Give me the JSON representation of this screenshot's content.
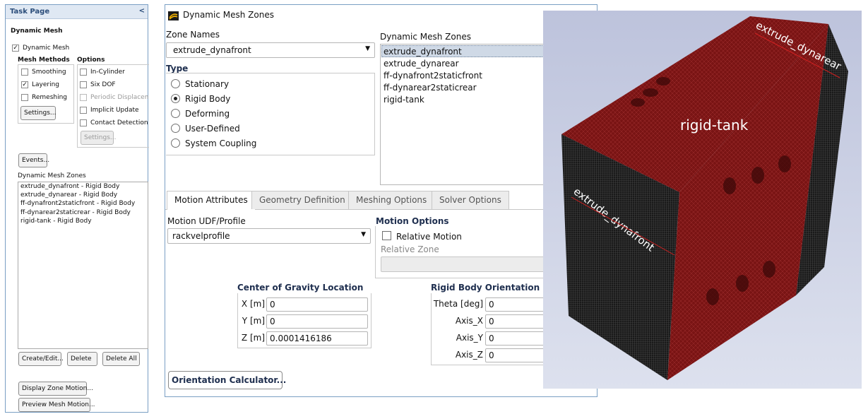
{
  "task_page": {
    "header": "Task Page",
    "collapse": "<",
    "title": "Dynamic Mesh",
    "dynamic_mesh_checkbox": "Dynamic Mesh",
    "mesh_methods_label": "Mesh Methods",
    "options_label": "Options",
    "mesh_methods": [
      {
        "label": "Smoothing",
        "checked": false
      },
      {
        "label": "Layering",
        "checked": true
      },
      {
        "label": "Remeshing",
        "checked": false
      }
    ],
    "mesh_settings_button": "Settings...",
    "options": [
      {
        "label": "In-Cylinder",
        "checked": false,
        "enabled": true
      },
      {
        "label": "Six DOF",
        "checked": false,
        "enabled": true
      },
      {
        "label": "Periodic Displaceme",
        "checked": false,
        "enabled": false
      },
      {
        "label": "Implicit Update",
        "checked": false,
        "enabled": true
      },
      {
        "label": "Contact Detection",
        "checked": false,
        "enabled": true
      }
    ],
    "options_settings_button": "Settings...",
    "events_button": "Events...",
    "zones_label": "Dynamic Mesh Zones",
    "zones": [
      "extrude_dynafront - Rigid Body",
      "extrude_dynarear - Rigid Body",
      "ff-dynafront2staticfront - Rigid Body",
      "ff-dynarear2staticrear - Rigid Body",
      "rigid-tank - Rigid Body"
    ],
    "create_edit_button": "Create/Edit...",
    "delete_button": "Delete",
    "delete_all_button": "Delete All",
    "display_zone_motion_button": "Display Zone Motion...",
    "preview_mesh_motion_button": "Preview Mesh Motion..."
  },
  "dialog": {
    "title": "Dynamic Mesh Zones",
    "zone_names_label": "Zone Names",
    "zone_name_value": "extrude_dynafront",
    "zones_list_label": "Dynamic Mesh Zones",
    "zones_list": [
      "extrude_dynafront",
      "extrude_dynarear",
      "ff-dynafront2staticfront",
      "ff-dynarear2staticrear",
      "rigid-tank"
    ],
    "type_label": "Type",
    "types": [
      {
        "label": "Stationary",
        "selected": false
      },
      {
        "label": "Rigid Body",
        "selected": true
      },
      {
        "label": "Deforming",
        "selected": false
      },
      {
        "label": "User-Defined",
        "selected": false
      },
      {
        "label": "System Coupling",
        "selected": false
      }
    ],
    "tabs": [
      "Motion Attributes",
      "Geometry Definition",
      "Meshing Options",
      "Solver Options"
    ],
    "motion_udf_label": "Motion UDF/Profile",
    "motion_udf_value": "rackvelprofile",
    "motion_options_label": "Motion Options",
    "relative_motion_label": "Relative Motion",
    "relative_zone_label": "Relative Zone",
    "cog_label": "Center of Gravity Location",
    "cog": [
      {
        "label": "X [m]",
        "value": "0"
      },
      {
        "label": "Y [m]",
        "value": "0"
      },
      {
        "label": "Z [m]",
        "value": "0.0001416186"
      }
    ],
    "orientation_label": "Rigid Body Orientation",
    "orientation": [
      {
        "label": "Theta [deg]",
        "value": "0"
      },
      {
        "label": "Axis_X",
        "value": "0"
      },
      {
        "label": "Axis_Y",
        "value": "0"
      },
      {
        "label": "Axis_Z",
        "value": "0"
      }
    ],
    "orientation_calculator_button": "Orientation Calculator..."
  },
  "view": {
    "label_top": "extrude_dynarear",
    "label_middle": "rigid-tank",
    "label_front": "extrude_dynafront",
    "colors": {
      "tank": "#7a1414",
      "side": "#1c1c1c",
      "background": "#c8cde3"
    }
  }
}
